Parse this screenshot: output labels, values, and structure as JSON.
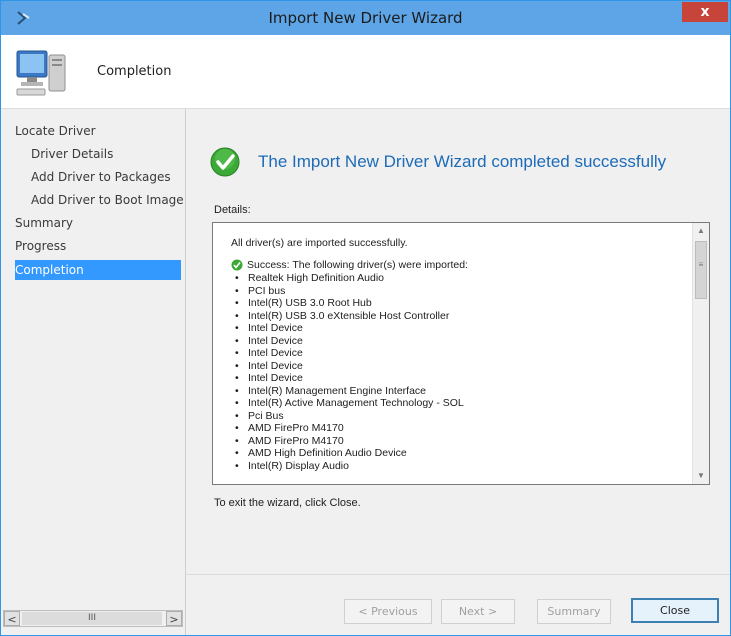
{
  "window": {
    "title": "Import New Driver Wizard",
    "close_glyph": "x"
  },
  "header": {
    "title": "Completion"
  },
  "nav": {
    "items": [
      {
        "label": "Locate Driver",
        "level": "top"
      },
      {
        "label": "Driver Details",
        "level": "sub"
      },
      {
        "label": "Add Driver to Packages",
        "level": "sub"
      },
      {
        "label": "Add Driver to Boot Image",
        "level": "sub"
      },
      {
        "label": "Summary",
        "level": "top"
      },
      {
        "label": "Progress",
        "level": "top"
      },
      {
        "label": "Completion",
        "level": "top",
        "selected": true
      }
    ],
    "scroll_left": "<",
    "scroll_thumb": "III",
    "scroll_right": ">"
  },
  "main": {
    "heading": "The Import New Driver Wizard completed successfully",
    "details_label": "Details:",
    "details": {
      "summary": "All driver(s) are imported successfully.",
      "success_line": "Success: The following driver(s) were imported:",
      "drivers": [
        "Realtek High Definition Audio",
        "PCI bus",
        "Intel(R) USB 3.0 Root Hub",
        "Intel(R) USB 3.0 eXtensible Host Controller",
        "Intel Device",
        "Intel Device",
        "Intel Device",
        "Intel Device",
        "Intel Device",
        "Intel(R) Management Engine Interface",
        "Intel(R) Active Management Technology - SOL",
        "Pci Bus",
        "AMD FirePro M4170",
        "AMD FirePro M4170",
        "AMD High Definition Audio Device",
        "Intel(R) Display Audio"
      ]
    },
    "exit_text": "To exit the wizard, click Close."
  },
  "footer": {
    "previous_label": "< Previous",
    "next_label": "Next >",
    "summary_label": "Summary",
    "close_label": "Close"
  },
  "colors": {
    "titlebar": "#5da5e6",
    "heading": "#1d6bb8",
    "selection": "#3399ff",
    "close_button": "#c7443a",
    "success_green": "#3aa935"
  },
  "icons": {
    "title": "wizard-arrow-icon",
    "header": "computer-icon",
    "success": "success-check-icon"
  }
}
